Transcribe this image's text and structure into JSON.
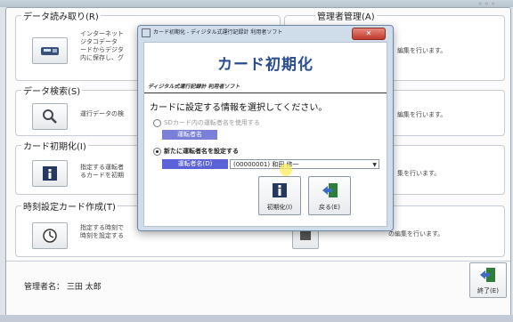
{
  "main": {
    "sections": [
      {
        "title": "データ読み取り(R)",
        "desc": [
          "インターネット",
          "ジタコデータ",
          "ードからデジタ",
          "内に保存し、グ"
        ],
        "right_desc": "編集を行います。"
      },
      {
        "title": "データ検索(S)",
        "desc": [
          "運行データの検"
        ],
        "right_desc": "編集を行います。"
      },
      {
        "title": "カード初期化(I)",
        "desc": [
          "指定する運転者",
          "るカードを初期"
        ],
        "right_desc": "集を行います。"
      },
      {
        "title": "時刻設定カード作成(T)",
        "desc": [
          "指定する時刻で",
          "時刻を設定する"
        ],
        "right_desc": "の編集を行います。"
      }
    ],
    "hidden_title": "管理者管理(A)",
    "admin_label": "管理者名：",
    "admin_name": "三田 太郎",
    "exit_label": "終了(E)"
  },
  "modal": {
    "window_title": "カード初期化 - ディジタル式運行記録計 利用者ソフト",
    "close_label": "✕",
    "banner_title": "カード初期化",
    "banner_subtitle": "ディジタル式運行記録計 利用者ソフト",
    "prompt": "カードに設定する情報を選択してください。",
    "option1_label": "SDカード内の運転者名を使用する",
    "option1_field_label": "運転者名",
    "option2_label": "新たに運転者名を設定する",
    "option2_field_label": "運転者名(D)",
    "driver_value": "(00000001) 和田 修一",
    "init_button": "初期化(I)",
    "back_button": "戻る(E)"
  },
  "colors": {
    "accent_blue": "#5b62d8",
    "title_blue": "#2a4d91",
    "modal_frame": "#cfdcea"
  }
}
